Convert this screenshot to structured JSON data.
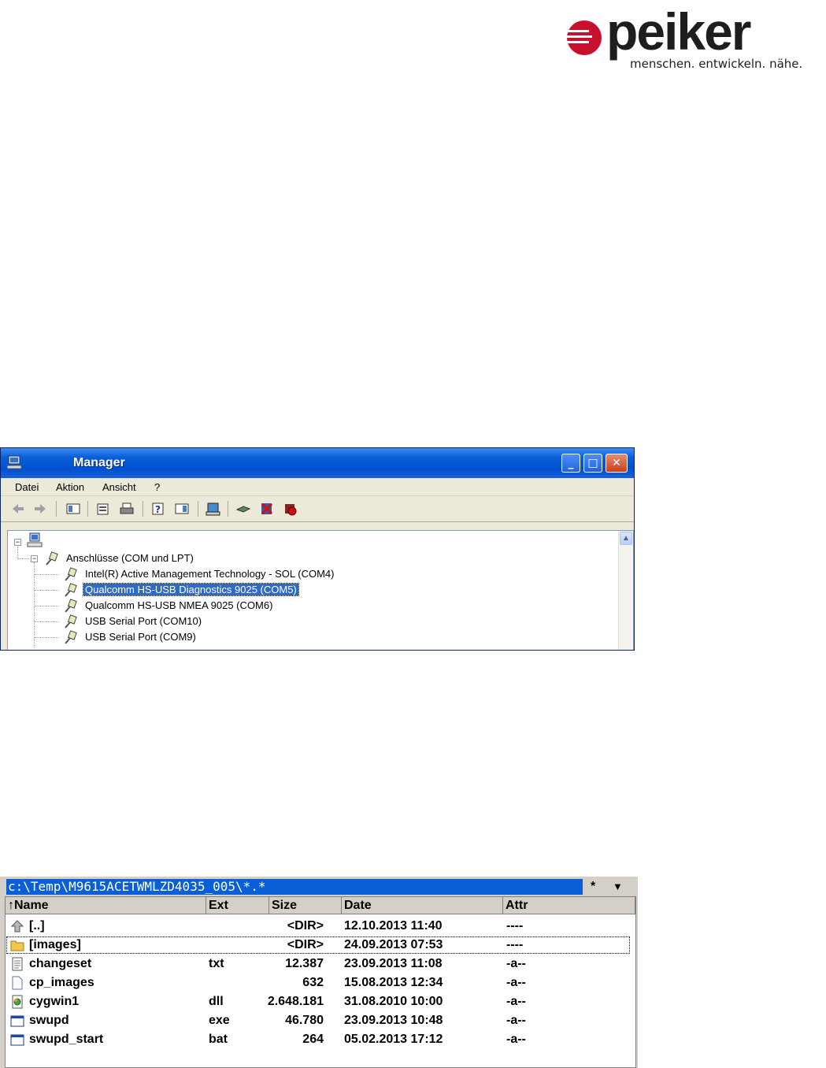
{
  "logo": {
    "word": "peiker",
    "tagline": "menschen. entwickeln. nähe.",
    "accent": "#c8102e"
  },
  "device_manager": {
    "title": "Manager",
    "menu": [
      "Datei",
      "Aktion",
      "Ansicht",
      "?"
    ],
    "tree": {
      "group_label": "Anschlüsse (COM und LPT)",
      "items": [
        {
          "label": "Intel(R) Active Management Technology - SOL (COM4)",
          "selected": false
        },
        {
          "label": "Qualcomm HS-USB Diagnostics 9025 (COM5)",
          "selected": true
        },
        {
          "label": "Qualcomm HS-USB NMEA 9025 (COM6)",
          "selected": false
        },
        {
          "label": "USB Serial Port (COM10)",
          "selected": false
        },
        {
          "label": "USB Serial Port (COM9)",
          "selected": false
        }
      ]
    },
    "toolbar_icons": [
      "back-icon",
      "forward-icon",
      "show-hide-tree-icon",
      "properties-icon",
      "print-icon",
      "help-icon",
      "view-icon",
      "scan-hardware-icon",
      "update-driver-icon",
      "uninstall-icon",
      "disable-icon"
    ]
  },
  "file_panel": {
    "path": "c:\\Temp\\M9615ACETWMLZD4035_005\\*.*",
    "filter_symbol": "*",
    "dropdown_symbol": "▼",
    "columns": {
      "name": "↑Name",
      "ext": "Ext",
      "size": "Size",
      "date": "Date",
      "attr": "Attr"
    },
    "rows": [
      {
        "name": "[..]",
        "ext": "",
        "size": "<DIR>",
        "date": "12.10.2013 11:40",
        "attr": "----",
        "icon": "up-folder-icon"
      },
      {
        "name": "[images]",
        "ext": "",
        "size": "<DIR>",
        "date": "24.09.2013 07:53",
        "attr": "----",
        "icon": "folder-icon"
      },
      {
        "name": "changeset",
        "ext": "txt",
        "size": "12.387",
        "date": "23.09.2013 11:08",
        "attr": "-a--",
        "icon": "text-file-icon"
      },
      {
        "name": "cp_images",
        "ext": "",
        "size": "632",
        "date": "15.08.2013 12:34",
        "attr": "-a--",
        "icon": "blank-file-icon"
      },
      {
        "name": "cygwin1",
        "ext": "dll",
        "size": "2.648.181",
        "date": "31.08.2010 10:00",
        "attr": "-a--",
        "icon": "dll-file-icon"
      },
      {
        "name": "swupd",
        "ext": "exe",
        "size": "46.780",
        "date": "23.09.2013 10:48",
        "attr": "-a--",
        "icon": "exe-file-icon"
      },
      {
        "name": "swupd_start",
        "ext": "bat",
        "size": "264",
        "date": "05.02.2013 17:12",
        "attr": "-a--",
        "icon": "bat-file-icon"
      }
    ]
  }
}
